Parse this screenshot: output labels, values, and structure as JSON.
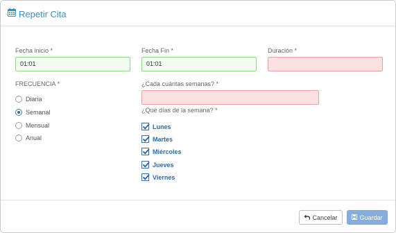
{
  "modal": {
    "title": "Repetir Cita"
  },
  "fields": {
    "start": {
      "label": "Fecha inicio *",
      "value": "01:01"
    },
    "end": {
      "label": "Fecha Fin *",
      "value": "01:01"
    },
    "duration": {
      "label": "Duración *",
      "value": ""
    },
    "weeks": {
      "label": "¿Cada cuántas semanas? *",
      "value": ""
    }
  },
  "frequency": {
    "label": "FRECUENCIA *",
    "options": [
      "Diaria",
      "Semanal",
      "Mensual",
      "Anual"
    ],
    "selected": "Semanal"
  },
  "days": {
    "label": "¿Qué días de la semana? *",
    "items": [
      {
        "label": "Lunes",
        "checked": true
      },
      {
        "label": "Martes",
        "checked": true
      },
      {
        "label": "Miércoles",
        "checked": true
      },
      {
        "label": "Jueves",
        "checked": true
      },
      {
        "label": "Viernes",
        "checked": true
      }
    ]
  },
  "footer": {
    "cancel_label": "Cancelar",
    "save_label": "Guardar"
  },
  "colors": {
    "accent": "#3c8dbc",
    "valid_bg": "#f0fcef",
    "error_bg": "#fde1e1",
    "save_bg": "#86addc"
  }
}
